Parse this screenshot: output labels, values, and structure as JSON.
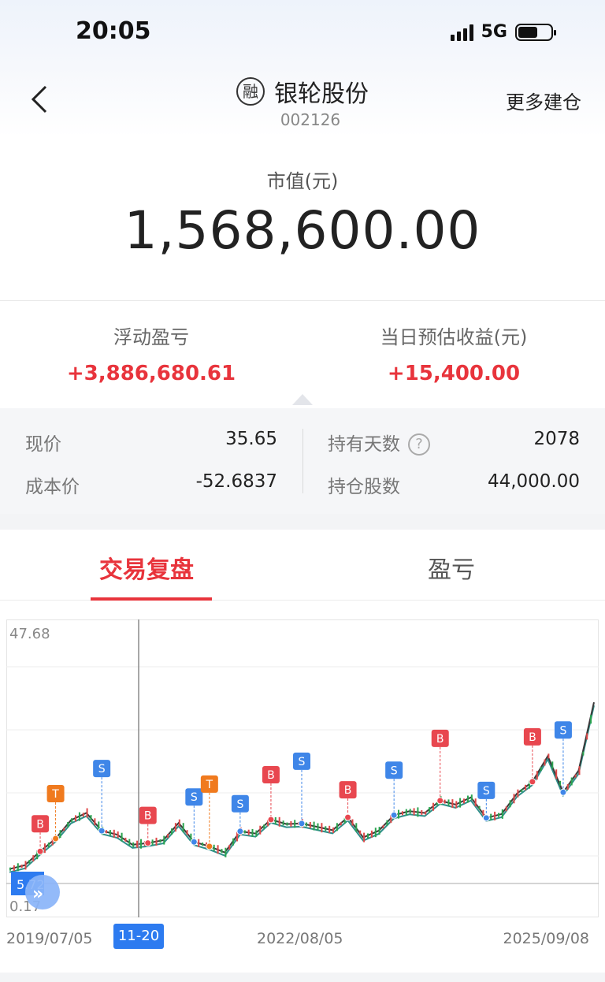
{
  "status_bar": {
    "time": "20:05",
    "network": "5G"
  },
  "nav": {
    "badge": "融",
    "title": "银轮股份",
    "code": "002126",
    "more_label": "更多建仓"
  },
  "market_value": {
    "label": "市值(元)",
    "value": "1,568,600.00"
  },
  "pnl": {
    "floating_label": "浮动盈亏",
    "floating_value": "+3,886,680.61",
    "today_label": "当日预估收益(元)",
    "today_value": "+15,400.00"
  },
  "details": {
    "price_label": "现价",
    "price_value": "35.65",
    "cost_label": "成本价",
    "cost_value": "-52.6837",
    "days_label": "持有天数",
    "days_help": "?",
    "days_value": "2078",
    "shares_label": "持仓股数",
    "shares_value": "44,000.00"
  },
  "tabs": [
    {
      "label": "交易复盘"
    },
    {
      "label": "盈亏"
    }
  ],
  "colors": {
    "accent": "#e8343c",
    "buy": "#e8474f",
    "sell": "#3f86e8",
    "t": "#f07a1e",
    "cursor": "#2d7bf0"
  },
  "chart_data": {
    "type": "line",
    "y_axis": {
      "top_label": "47.68",
      "bottom_label": "0.17",
      "cursor_value_label": "5.72"
    },
    "x_axis": {
      "start_label": "2019/07/05",
      "mid_label": "2022/08/05",
      "end_label": "2025/09/08",
      "cursor_label": "11-20"
    },
    "ylim": [
      0.17,
      47.68
    ],
    "series": [
      {
        "values": [
          5.72,
          6.4,
          8.9,
          11.2,
          14.5,
          15.8,
          12.6,
          11.9,
          10.1,
          10.4,
          10.9,
          14.0,
          10.6,
          9.8,
          8.7,
          12.5,
          12.1,
          14.6,
          13.8,
          13.9,
          13.3,
          12.7,
          15.0,
          11.4,
          12.6,
          15.4,
          16.1,
          15.8,
          18.0,
          17.3,
          18.6,
          14.9,
          15.6,
          19.3,
          21.4,
          26.0,
          19.5,
          23.4,
          35.65
        ]
      }
    ],
    "markers": [
      "B",
      "T",
      "S",
      "B",
      "S",
      "T",
      "S",
      "B",
      "S",
      "B",
      "S",
      "B",
      "S",
      "B",
      "S"
    ]
  }
}
